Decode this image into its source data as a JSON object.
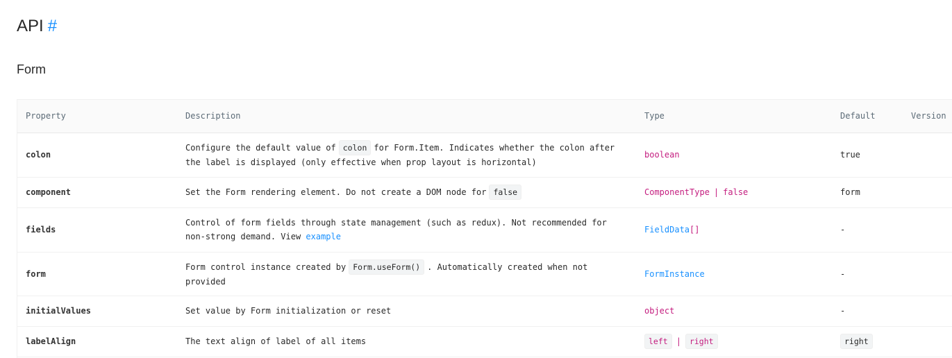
{
  "heading": {
    "title": "API",
    "anchor": "#"
  },
  "section": {
    "title": "Form"
  },
  "table": {
    "headers": {
      "property": "Property",
      "description": "Description",
      "type": "Type",
      "default": "Default",
      "version": "Version"
    },
    "rows": [
      {
        "property": "colon",
        "desc_pre": "Configure the default value of",
        "desc_code": "colon",
        "desc_post": "for Form.Item. Indicates whether the colon after the label is displayed (only effective when prop layout is horizontal)",
        "type": "boolean",
        "default": "true"
      },
      {
        "property": "component",
        "desc_pre": "Set the Form rendering element. Do not create a DOM node for",
        "desc_code": "false",
        "type_a": "ComponentType",
        "type_sep": "|",
        "type_b": "false",
        "default": "form"
      },
      {
        "property": "fields",
        "desc_pre": "Control of form fields through state management (such as redux). Not recommended for non-strong demand. View",
        "desc_link": "example",
        "type_link": "FieldData",
        "type_suffix": "[]",
        "default": "-"
      },
      {
        "property": "form",
        "desc_pre": "Form control instance created by",
        "desc_code": "Form.useForm()",
        "desc_post": ". Automatically created when not provided",
        "type_link": "FormInstance",
        "default": "-"
      },
      {
        "property": "initialValues",
        "desc_pre": "Set value by Form initialization or reset",
        "type": "object",
        "default": "-"
      },
      {
        "property": "labelAlign",
        "desc_pre": "The text align of label of all items",
        "type_code_a": "left",
        "type_sep": "|",
        "type_code_b": "right",
        "default_code": "right"
      }
    ]
  }
}
